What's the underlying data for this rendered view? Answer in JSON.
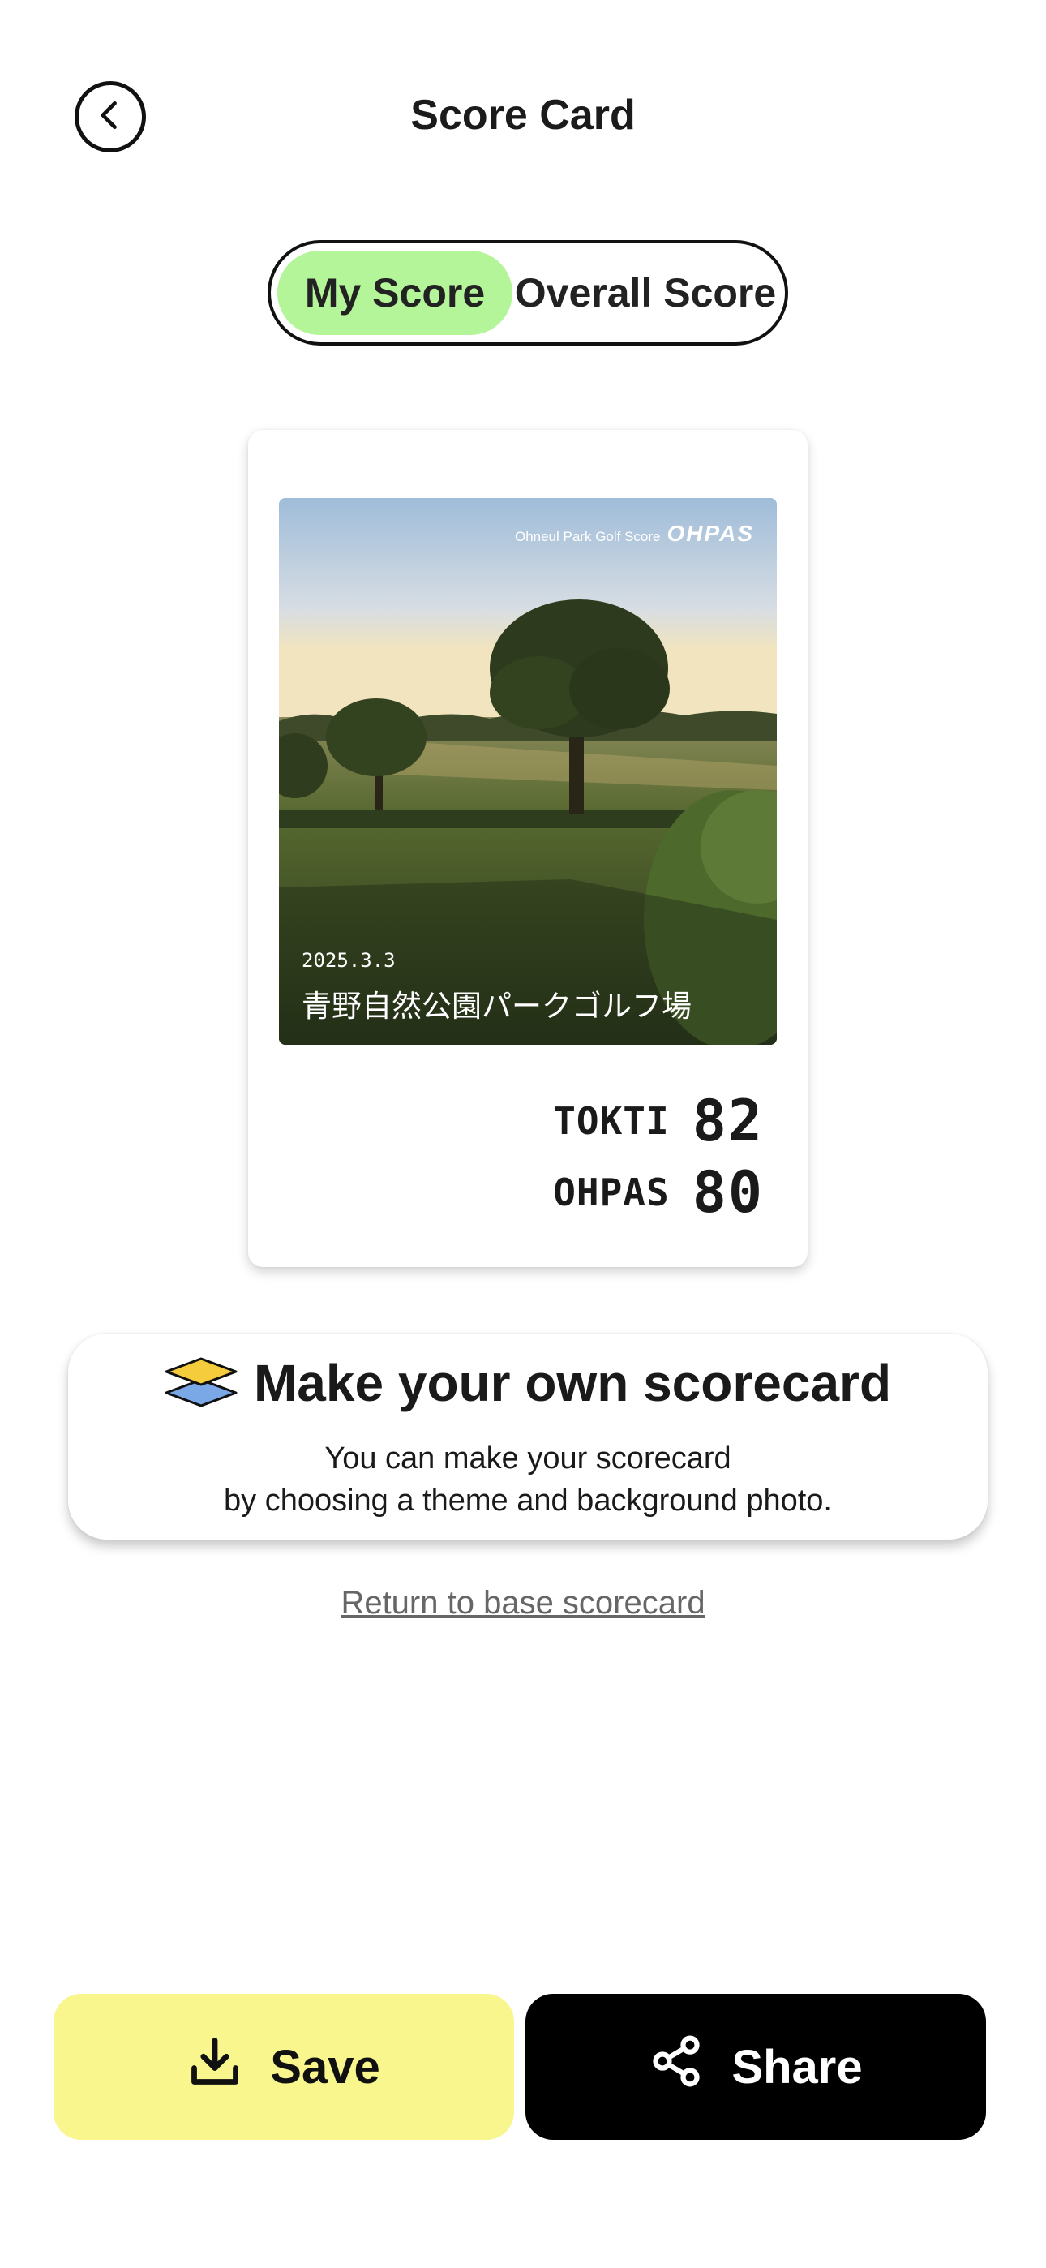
{
  "header": {
    "title": "Score Card"
  },
  "toggle": {
    "my_score": "My Score",
    "overall_score": "Overall Score",
    "active": "My Score"
  },
  "card": {
    "brand_text": "Ohneul Park Golf Score",
    "brand_logo": "OHPAS",
    "date": "2025.3.3",
    "venue": "青野自然公園パークゴルフ場",
    "scores": [
      {
        "name": "TOKTI",
        "value": "82"
      },
      {
        "name": "OHPAS",
        "value": "80"
      }
    ]
  },
  "promo": {
    "title": "Make your own scorecard",
    "line1": "You can make your scorecard",
    "line2": "by choosing a theme and background photo."
  },
  "return_link": "Return to base scorecard",
  "actions": {
    "save": "Save",
    "share": "Share"
  },
  "colors": {
    "toggle_active": "#b4f59a",
    "save_bg": "#f8f68c",
    "share_bg": "#000000"
  },
  "icons": {
    "back": "chevron-left-icon",
    "layers": "layers-icon",
    "save": "download-icon",
    "share": "share-icon"
  }
}
